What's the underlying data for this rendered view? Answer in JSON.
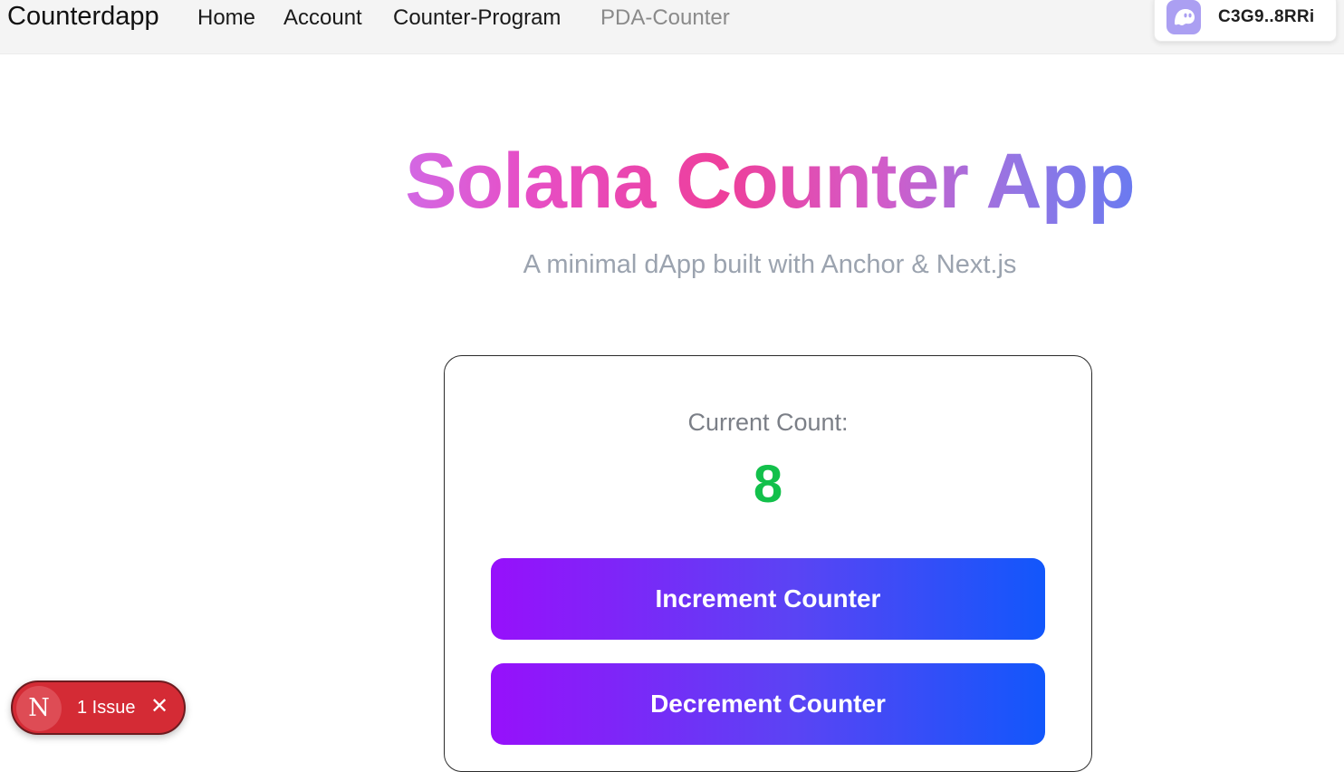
{
  "navbar": {
    "brand": "Counterdapp",
    "links": [
      {
        "label": "Home",
        "active": false
      },
      {
        "label": "Account",
        "active": false
      },
      {
        "label": "Counter-Program",
        "active": false
      },
      {
        "label": "PDA-Counter",
        "active": true
      }
    ],
    "wallet": {
      "icon": "phantom-ghost-icon",
      "address": "C3G9..8RRi"
    }
  },
  "hero": {
    "title": "Solana Counter App",
    "subtitle": "A minimal dApp built with Anchor & Next.js"
  },
  "counter": {
    "label": "Current Count:",
    "value": "8",
    "increment_label": "Increment Counter",
    "decrement_label": "Decrement Counter"
  },
  "dev_overlay": {
    "logo_letter": "N",
    "issues_label": "1 Issue",
    "close_glyph": "✕"
  },
  "colors": {
    "count_value": "#12c04b",
    "button_gradient_start": "#9710fb",
    "button_gradient_end": "#1257fb",
    "issue_badge": "#d42b35",
    "active_nav": "#8a8a8a"
  }
}
